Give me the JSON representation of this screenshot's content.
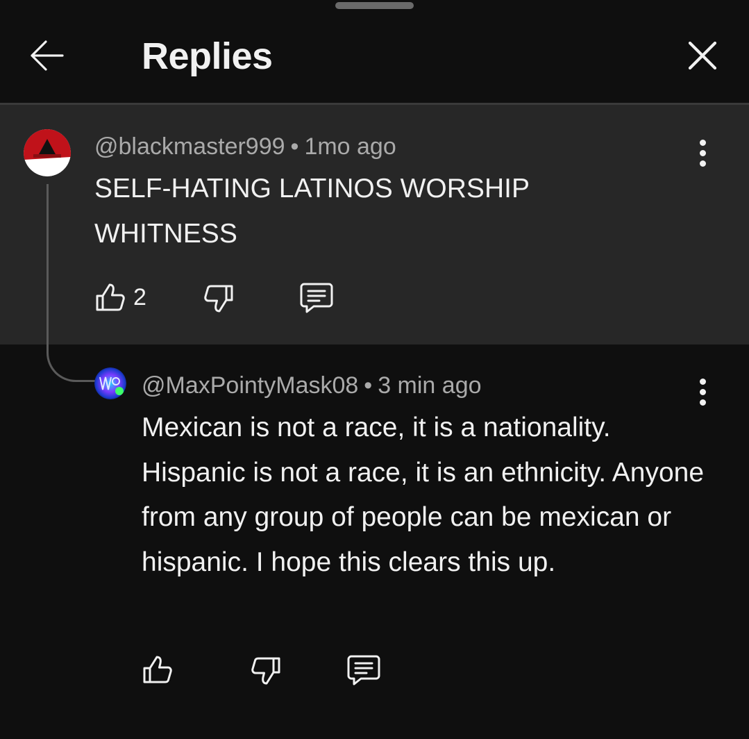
{
  "header": {
    "title": "Replies",
    "back_icon": "arrow-left-icon",
    "close_icon": "close-icon"
  },
  "parent_comment": {
    "handle": "@blackmaster999",
    "separator": "•",
    "time": "1mo ago",
    "text": "SELF-HATING LATINOS WORSHIP WHITNESS",
    "like_count": "2",
    "avatar_colors": {
      "outer": "#c0121a",
      "inner": "#ffffff"
    }
  },
  "reply_comment": {
    "handle": "@MaxPointyMask08",
    "separator": "•",
    "time": "3 min ago",
    "text": "Mexican is not a race, it is a nationality. Hispanic is not a race, it is an ethnicity. Anyone from any group of people can be mexican or hispanic. I hope this clears this up.",
    "like_count": ""
  },
  "colors": {
    "background": "#0f0f0f",
    "highlight_background": "#272727",
    "text_primary": "#f1f1f1",
    "text_secondary": "#aaaaaa"
  }
}
